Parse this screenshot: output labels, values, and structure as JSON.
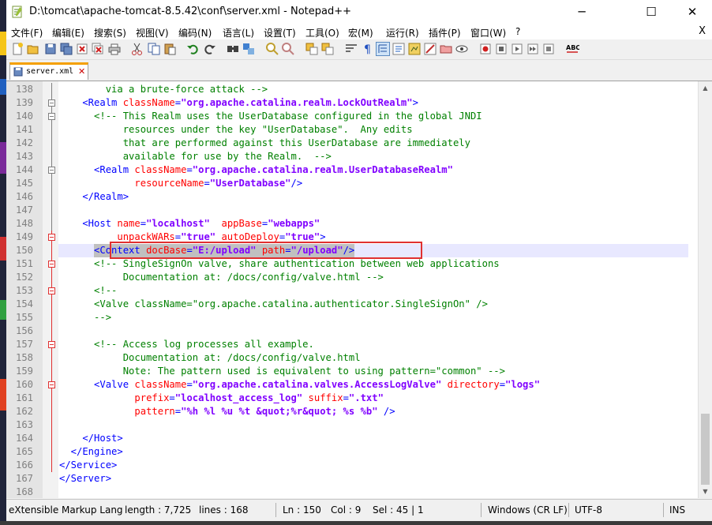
{
  "window": {
    "title": "D:\\tomcat\\apache-tomcat-8.5.42\\conf\\server.xml - Notepad++",
    "minimize": "─",
    "maximize": "☐",
    "close": "✕"
  },
  "menu": {
    "items": [
      "文件(F)",
      "编辑(E)",
      "搜索(S)",
      "视图(V)",
      "编码(N)",
      "语言(L)",
      "设置(T)",
      "工具(O)",
      "宏(M)",
      "运行(R)",
      "插件(P)",
      "窗口(W)",
      "?"
    ],
    "close_doc": "X"
  },
  "toolbar": {
    "icons": [
      "new-icon",
      "open-icon",
      "save-icon",
      "save-all-icon",
      "close-icon",
      "close-all-icon",
      "print-icon",
      "cut-icon",
      "copy-icon",
      "paste-icon",
      "undo-icon",
      "redo-icon",
      "find-icon",
      "replace-icon",
      "zoom-in-icon",
      "zoom-out-icon",
      "sync-v-icon",
      "sync-h-icon",
      "wrap-icon",
      "all-chars-icon",
      "indent-guide-icon",
      "udl-icon",
      "doc-map-icon",
      "func-list-icon",
      "folder-icon",
      "monitor-icon",
      "record-icon",
      "stop-icon",
      "play-icon",
      "play-multi-icon",
      "save-macro-icon",
      "spellcheck-icon"
    ]
  },
  "tab": {
    "label": "server.xml"
  },
  "editor": {
    "lines": [
      {
        "n": "138",
        "segs": [
          [
            "c",
            "        via a brute-force attack -->"
          ]
        ]
      },
      {
        "n": "139",
        "segs": [
          [
            "t",
            "    <Realm "
          ],
          [
            "a",
            "className"
          ],
          [
            "t",
            "="
          ],
          [
            "v",
            "\"org.apache.catalina.realm.LockOutRealm\""
          ],
          [
            "t",
            ">"
          ]
        ]
      },
      {
        "n": "140",
        "segs": [
          [
            "c",
            "      <!-- This Realm uses the UserDatabase configured in the global JNDI"
          ]
        ]
      },
      {
        "n": "141",
        "segs": [
          [
            "c",
            "           resources under the key \"UserDatabase\".  Any edits"
          ]
        ]
      },
      {
        "n": "142",
        "segs": [
          [
            "c",
            "           that are performed against this UserDatabase are immediately"
          ]
        ]
      },
      {
        "n": "143",
        "segs": [
          [
            "c",
            "           available for use by the Realm.  -->"
          ]
        ]
      },
      {
        "n": "144",
        "segs": [
          [
            "t",
            "      <Realm "
          ],
          [
            "a",
            "className"
          ],
          [
            "t",
            "="
          ],
          [
            "v",
            "\"org.apache.catalina.realm.UserDatabaseRealm\""
          ]
        ]
      },
      {
        "n": "145",
        "segs": [
          [
            "t",
            "             "
          ],
          [
            "a",
            "resourceName"
          ],
          [
            "t",
            "="
          ],
          [
            "v",
            "\"UserDatabase\""
          ],
          [
            "t",
            "/>"
          ]
        ]
      },
      {
        "n": "146",
        "segs": [
          [
            "t",
            "    </Realm>"
          ]
        ]
      },
      {
        "n": "147",
        "segs": []
      },
      {
        "n": "148",
        "segs": [
          [
            "t",
            "    <Host "
          ],
          [
            "a",
            "name"
          ],
          [
            "t",
            "="
          ],
          [
            "v",
            "\"localhost\""
          ],
          [
            "t",
            "  "
          ],
          [
            "a",
            "appBase"
          ],
          [
            "t",
            "="
          ],
          [
            "v",
            "\"webapps\""
          ]
        ]
      },
      {
        "n": "149",
        "segs": [
          [
            "t",
            "          "
          ],
          [
            "a",
            "unpackWARs"
          ],
          [
            "t",
            "="
          ],
          [
            "v",
            "\"true\""
          ],
          [
            "t",
            " "
          ],
          [
            "a",
            "autoDeploy"
          ],
          [
            "t",
            "="
          ],
          [
            "v",
            "\"true\""
          ],
          [
            "t",
            ">"
          ]
        ]
      },
      {
        "n": "150",
        "segs": [
          [
            "t",
            "      <Context "
          ],
          [
            "a",
            "docBase"
          ],
          [
            "t",
            "="
          ],
          [
            "v",
            "\"E:/upload\""
          ],
          [
            "t",
            " "
          ],
          [
            "a",
            "path"
          ],
          [
            "t",
            "="
          ],
          [
            "v",
            "\"/upload\""
          ],
          [
            "t",
            "/>"
          ]
        ]
      },
      {
        "n": "151",
        "segs": [
          [
            "c",
            "      <!-- SingleSignOn valve, share authentication between web applications"
          ]
        ]
      },
      {
        "n": "152",
        "segs": [
          [
            "c",
            "           Documentation at: /docs/config/valve.html -->"
          ]
        ]
      },
      {
        "n": "153",
        "segs": [
          [
            "c",
            "      <!--"
          ]
        ]
      },
      {
        "n": "154",
        "segs": [
          [
            "c",
            "      <Valve className=\"org.apache.catalina.authenticator.SingleSignOn\" />"
          ]
        ]
      },
      {
        "n": "155",
        "segs": [
          [
            "c",
            "      -->"
          ]
        ]
      },
      {
        "n": "156",
        "segs": []
      },
      {
        "n": "157",
        "segs": [
          [
            "c",
            "      <!-- Access log processes all example."
          ]
        ]
      },
      {
        "n": "158",
        "segs": [
          [
            "c",
            "           Documentation at: /docs/config/valve.html"
          ]
        ]
      },
      {
        "n": "159",
        "segs": [
          [
            "c",
            "           Note: The pattern used is equivalent to using pattern=\"common\" -->"
          ]
        ]
      },
      {
        "n": "160",
        "segs": [
          [
            "t",
            "      <Valve "
          ],
          [
            "a",
            "className"
          ],
          [
            "t",
            "="
          ],
          [
            "v",
            "\"org.apache.catalina.valves.AccessLogValve\""
          ],
          [
            "t",
            " "
          ],
          [
            "a",
            "directory"
          ],
          [
            "t",
            "="
          ],
          [
            "v",
            "\"logs\""
          ]
        ]
      },
      {
        "n": "161",
        "segs": [
          [
            "t",
            "             "
          ],
          [
            "a",
            "prefix"
          ],
          [
            "t",
            "="
          ],
          [
            "v",
            "\"localhost_access_log\""
          ],
          [
            "t",
            " "
          ],
          [
            "a",
            "suffix"
          ],
          [
            "t",
            "="
          ],
          [
            "v",
            "\".txt\""
          ]
        ]
      },
      {
        "n": "162",
        "segs": [
          [
            "t",
            "             "
          ],
          [
            "a",
            "pattern"
          ],
          [
            "t",
            "="
          ],
          [
            "v",
            "\"%h %l %u %t &quot;%r&quot; %s %b\""
          ],
          [
            "t",
            " />"
          ]
        ]
      },
      {
        "n": "163",
        "segs": []
      },
      {
        "n": "164",
        "segs": [
          [
            "t",
            "    </Host>"
          ]
        ]
      },
      {
        "n": "165",
        "segs": [
          [
            "t",
            "  </Engine>"
          ]
        ]
      },
      {
        "n": "166",
        "segs": [
          [
            "t",
            "</Service>"
          ]
        ]
      },
      {
        "n": "167",
        "segs": [
          [
            "t",
            "</Server>"
          ]
        ]
      },
      {
        "n": "168",
        "segs": []
      }
    ]
  },
  "status": {
    "file_type": "eXtensible Markup Lang",
    "length": "length : 7,725",
    "lines": "lines : 168",
    "ln": "Ln : 150",
    "col": "Col : 9",
    "sel": "Sel : 45 | 1",
    "eol": "Windows (CR LF)",
    "encoding": "UTF-8",
    "mode": "INS"
  },
  "colors": {
    "tag": "#0000ff",
    "attr": "#ff0000",
    "value": "#8000ff",
    "comment": "#008000",
    "line_number": "#808080",
    "current_line": "#e8e8ff",
    "highlight_box": "#e03030"
  }
}
